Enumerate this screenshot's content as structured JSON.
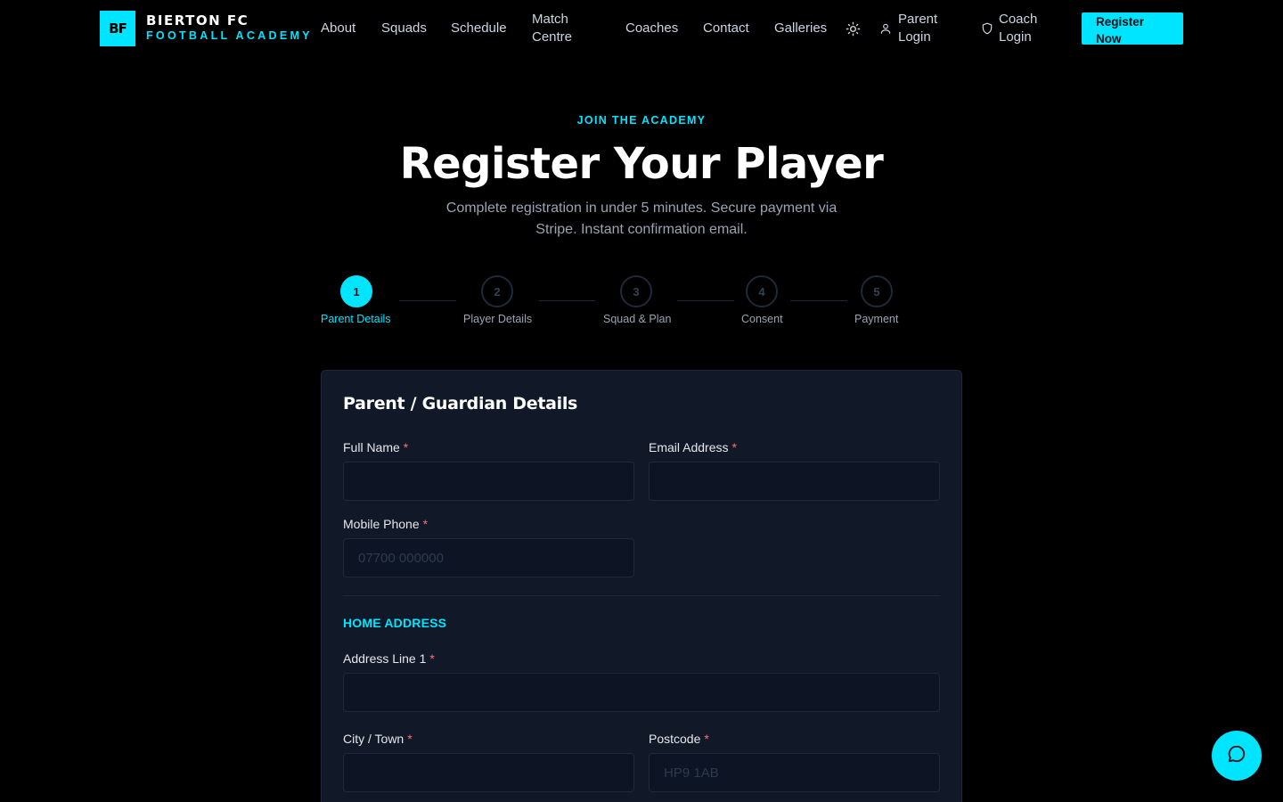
{
  "brand": {
    "logo_initials": "BF",
    "name": "BIERTON FC",
    "subtitle": "FOOTBALL ACADEMY"
  },
  "nav": {
    "items": [
      "About",
      "Squads",
      "Schedule",
      "Match Centre",
      "Coaches",
      "Contact",
      "Galleries"
    ],
    "theme_toggle_icon": "sun-icon",
    "parent_login": "Parent Login",
    "coach_login": "Coach Login",
    "register_button": "Register Now"
  },
  "hero": {
    "eyebrow": "JOIN THE ACADEMY",
    "title": "Register Your Player",
    "subtitle": "Complete registration in under 5 minutes. Secure payment via Stripe. Instant confirmation email."
  },
  "stepper": {
    "current_step": 1,
    "steps": [
      {
        "number": "1",
        "label": "Parent Details"
      },
      {
        "number": "2",
        "label": "Player Details"
      },
      {
        "number": "3",
        "label": "Squad & Plan"
      },
      {
        "number": "4",
        "label": "Consent"
      },
      {
        "number": "5",
        "label": "Payment"
      }
    ]
  },
  "form": {
    "title": "Parent / Guardian Details",
    "required_marker": "*",
    "fields": {
      "full_name": {
        "label": "Full Name",
        "value": "",
        "placeholder": ""
      },
      "email": {
        "label": "Email Address",
        "value": "",
        "placeholder": ""
      },
      "mobile": {
        "label": "Mobile Phone",
        "value": "",
        "placeholder": "07700 000000"
      },
      "address1": {
        "label": "Address Line 1",
        "value": "",
        "placeholder": ""
      },
      "city": {
        "label": "City / Town",
        "value": "",
        "placeholder": ""
      },
      "postcode": {
        "label": "Postcode",
        "value": "",
        "placeholder": "HP9 1AB"
      }
    },
    "address_section": "HOME ADDRESS"
  },
  "chat": {
    "icon": "chat-bubble-icon"
  },
  "colors": {
    "accent": "#00e5ff",
    "background": "#000000",
    "card": "#111827",
    "required": "#f87171"
  }
}
